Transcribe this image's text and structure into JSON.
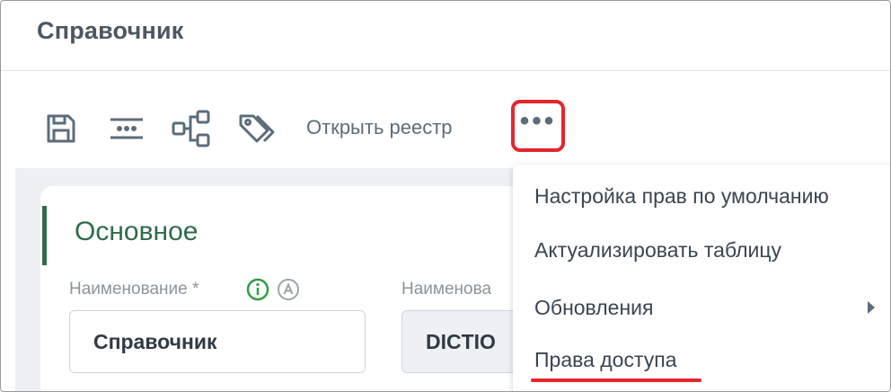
{
  "header": {
    "title": "Справочник"
  },
  "toolbar": {
    "save_icon": "save-icon",
    "list_icon": "list-icon",
    "tree_icon": "hierarchy-icon",
    "tags_icon": "tags-icon",
    "open_registry_label": "Открыть реестр",
    "more_label": "•••"
  },
  "section": {
    "title": "Основное"
  },
  "fields": {
    "name_label": "Наименование *",
    "name_value": "Справочник",
    "name2_label": "Наименова",
    "name2_value": "DICTIO"
  },
  "menu": {
    "items": [
      {
        "label": "Настройка прав по умолчанию"
      },
      {
        "label": "Актуализировать таблицу"
      },
      {
        "label": "Обновления"
      },
      {
        "label": "Права доступа"
      }
    ]
  },
  "colors": {
    "accent": "#2e6b4a",
    "highlight": "#e4262e",
    "icon": "#5c6c7b",
    "info_green": "#2f9e44"
  }
}
